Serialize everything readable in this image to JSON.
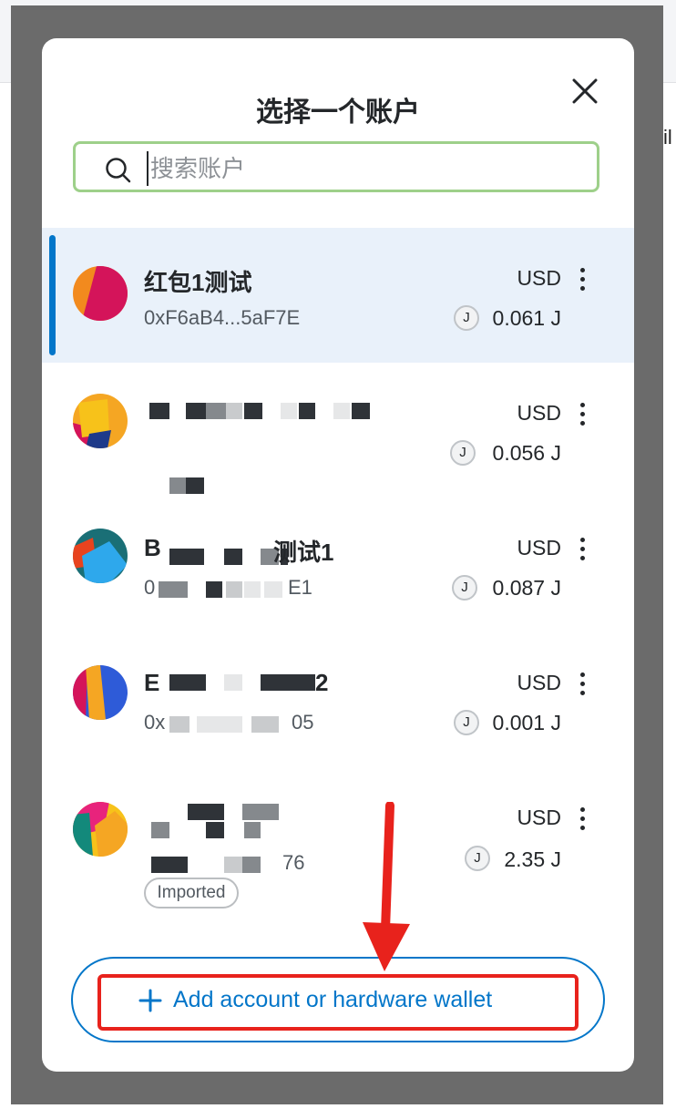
{
  "modal": {
    "title": "选择一个账户",
    "close_icon": "close-icon"
  },
  "search": {
    "placeholder": "搜索账户",
    "value": "",
    "icon": "search-icon"
  },
  "accounts": [
    {
      "name": "红包1测试",
      "address": "0xF6aB4...5aF7E",
      "currency": "USD",
      "token": "J",
      "balance": "0.061 J",
      "selected": true
    },
    {
      "name": "",
      "address": "",
      "currency": "USD",
      "token": "J",
      "balance": "0.056 J",
      "selected": false
    },
    {
      "name_start": "B",
      "name_end": "测试1",
      "address_start": "0",
      "address_end": "E1",
      "currency": "USD",
      "token": "J",
      "balance": "0.087 J",
      "selected": false
    },
    {
      "name_start": "E",
      "name_end": "2",
      "address_start": "0x",
      "address_end": "05",
      "currency": "USD",
      "token": "J",
      "balance": "0.001 J",
      "selected": false
    },
    {
      "name": "",
      "address_end": "76",
      "currency": "USD",
      "token": "J",
      "balance": "2.35 J",
      "badge": "Imported",
      "selected": false
    }
  ],
  "add_button": {
    "label": "Add account or hardware wallet",
    "icon": "plus-icon"
  },
  "colors": {
    "accent": "#0376c9",
    "selected_row": "#e9f1fa",
    "search_border": "#9ed08a",
    "annotation": "#e8221c"
  },
  "background": {
    "edge_text": "il"
  }
}
